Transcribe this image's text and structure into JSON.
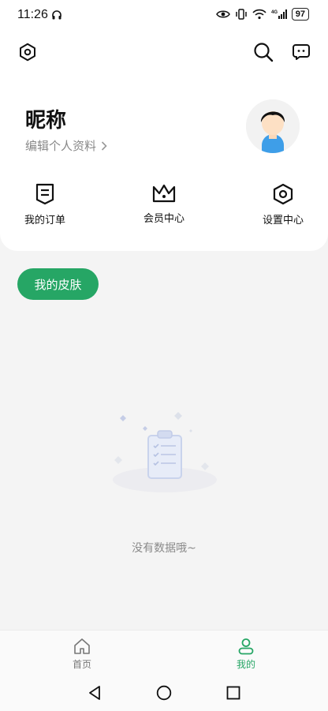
{
  "status_bar": {
    "time": "11:26",
    "battery": "97",
    "network": "4G"
  },
  "header": {
    "settings_icon": "hexagon-gear-icon",
    "search_icon": "search-icon",
    "message_icon": "message-icon"
  },
  "profile": {
    "nickname": "昵称",
    "edit_link": "编辑个人资料"
  },
  "quick_actions": [
    {
      "label": "我的订单",
      "icon": "order-icon"
    },
    {
      "label": "会员中心",
      "icon": "crown-icon"
    },
    {
      "label": "设置中心",
      "icon": "settings-hexagon-icon"
    }
  ],
  "skin_button": "我的皮肤",
  "empty_state": {
    "text": "没有数据哦~"
  },
  "tabbar": {
    "tabs": [
      {
        "label": "首页",
        "icon": "home-icon",
        "active": false
      },
      {
        "label": "我的",
        "icon": "user-icon",
        "active": true
      }
    ]
  },
  "colors": {
    "accent": "#26a665",
    "background": "#f4f4f4"
  }
}
